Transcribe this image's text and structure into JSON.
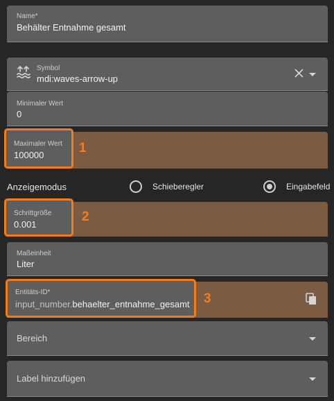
{
  "name_field": {
    "label": "Name*",
    "value": "Behälter Entnahme gesamt"
  },
  "symbol_field": {
    "label": "Symbol",
    "value": "mdi:waves-arrow-up",
    "icon": "waves-arrow-up-icon"
  },
  "min_field": {
    "label": "Minimaler Wert",
    "value": "0"
  },
  "max_field": {
    "label": "Maximaler Wert",
    "value": "100000",
    "callout": "1"
  },
  "display_mode": {
    "label": "Anzeigemodus",
    "options": [
      {
        "label": "Schieberegler",
        "selected": false
      },
      {
        "label": "Eingabefeld",
        "selected": true
      }
    ]
  },
  "step_field": {
    "label": "Schrittgröße",
    "value": "0.001",
    "callout": "2"
  },
  "unit_field": {
    "label": "Maßeinheit",
    "value": "Liter"
  },
  "entity_field": {
    "label": "Entitäts-ID*",
    "prefix": "input_number.",
    "value": "behaelter_entnahme_gesamt",
    "callout": "3"
  },
  "area_field": {
    "label": "Bereich"
  },
  "labels_field": {
    "label": "Label hinzufügen"
  },
  "colors": {
    "accent": "#f57c18",
    "highlight_bg": "#7c5b43",
    "field_bg": "#5e5e5e",
    "page_bg": "#262626"
  }
}
